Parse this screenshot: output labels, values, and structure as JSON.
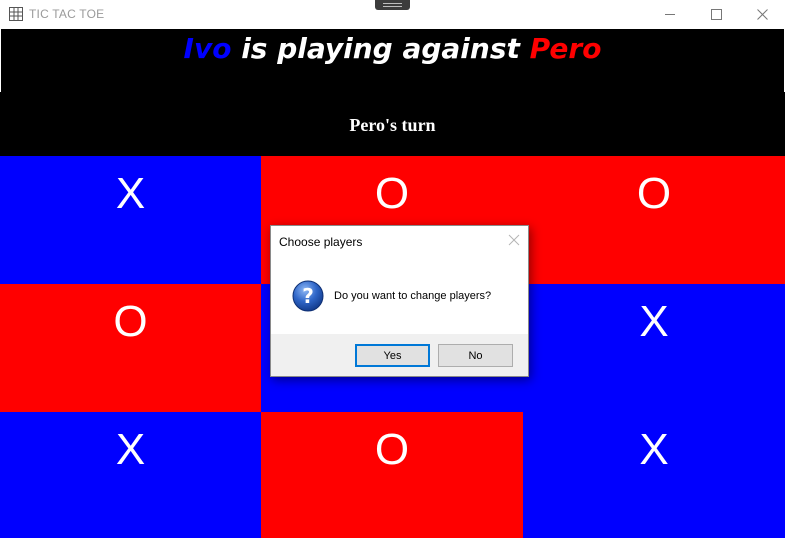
{
  "window": {
    "title": "TIC TAC TOE",
    "icons": {
      "app": "grid-app-icon",
      "minimize": "minimize-icon",
      "maximize": "maximize-icon",
      "close": "close-icon"
    }
  },
  "header": {
    "player1": "Ivo",
    "middle": " is playing against ",
    "player2": "Pero",
    "player1_color": "#0000ff",
    "player2_color": "#ff0000",
    "text_color": "#ffffff"
  },
  "turn": {
    "text": "Pero's turn"
  },
  "board": {
    "cells": [
      {
        "mark": "X",
        "color": "#0000ff"
      },
      {
        "mark": "O",
        "color": "#ff0000"
      },
      {
        "mark": "O",
        "color": "#ff0000"
      },
      {
        "mark": "O",
        "color": "#ff0000"
      },
      {
        "mark": "",
        "color": "#0000ff"
      },
      {
        "mark": "X",
        "color": "#0000ff"
      },
      {
        "mark": "X",
        "color": "#0000ff"
      },
      {
        "mark": "O",
        "color": "#ff0000"
      },
      {
        "mark": "X",
        "color": "#0000ff"
      }
    ]
  },
  "dialog": {
    "title": "Choose players",
    "message": "Do you want to change players?",
    "yes_label": "Yes",
    "no_label": "No",
    "icons": {
      "question": "question-icon",
      "close": "close-icon"
    }
  }
}
